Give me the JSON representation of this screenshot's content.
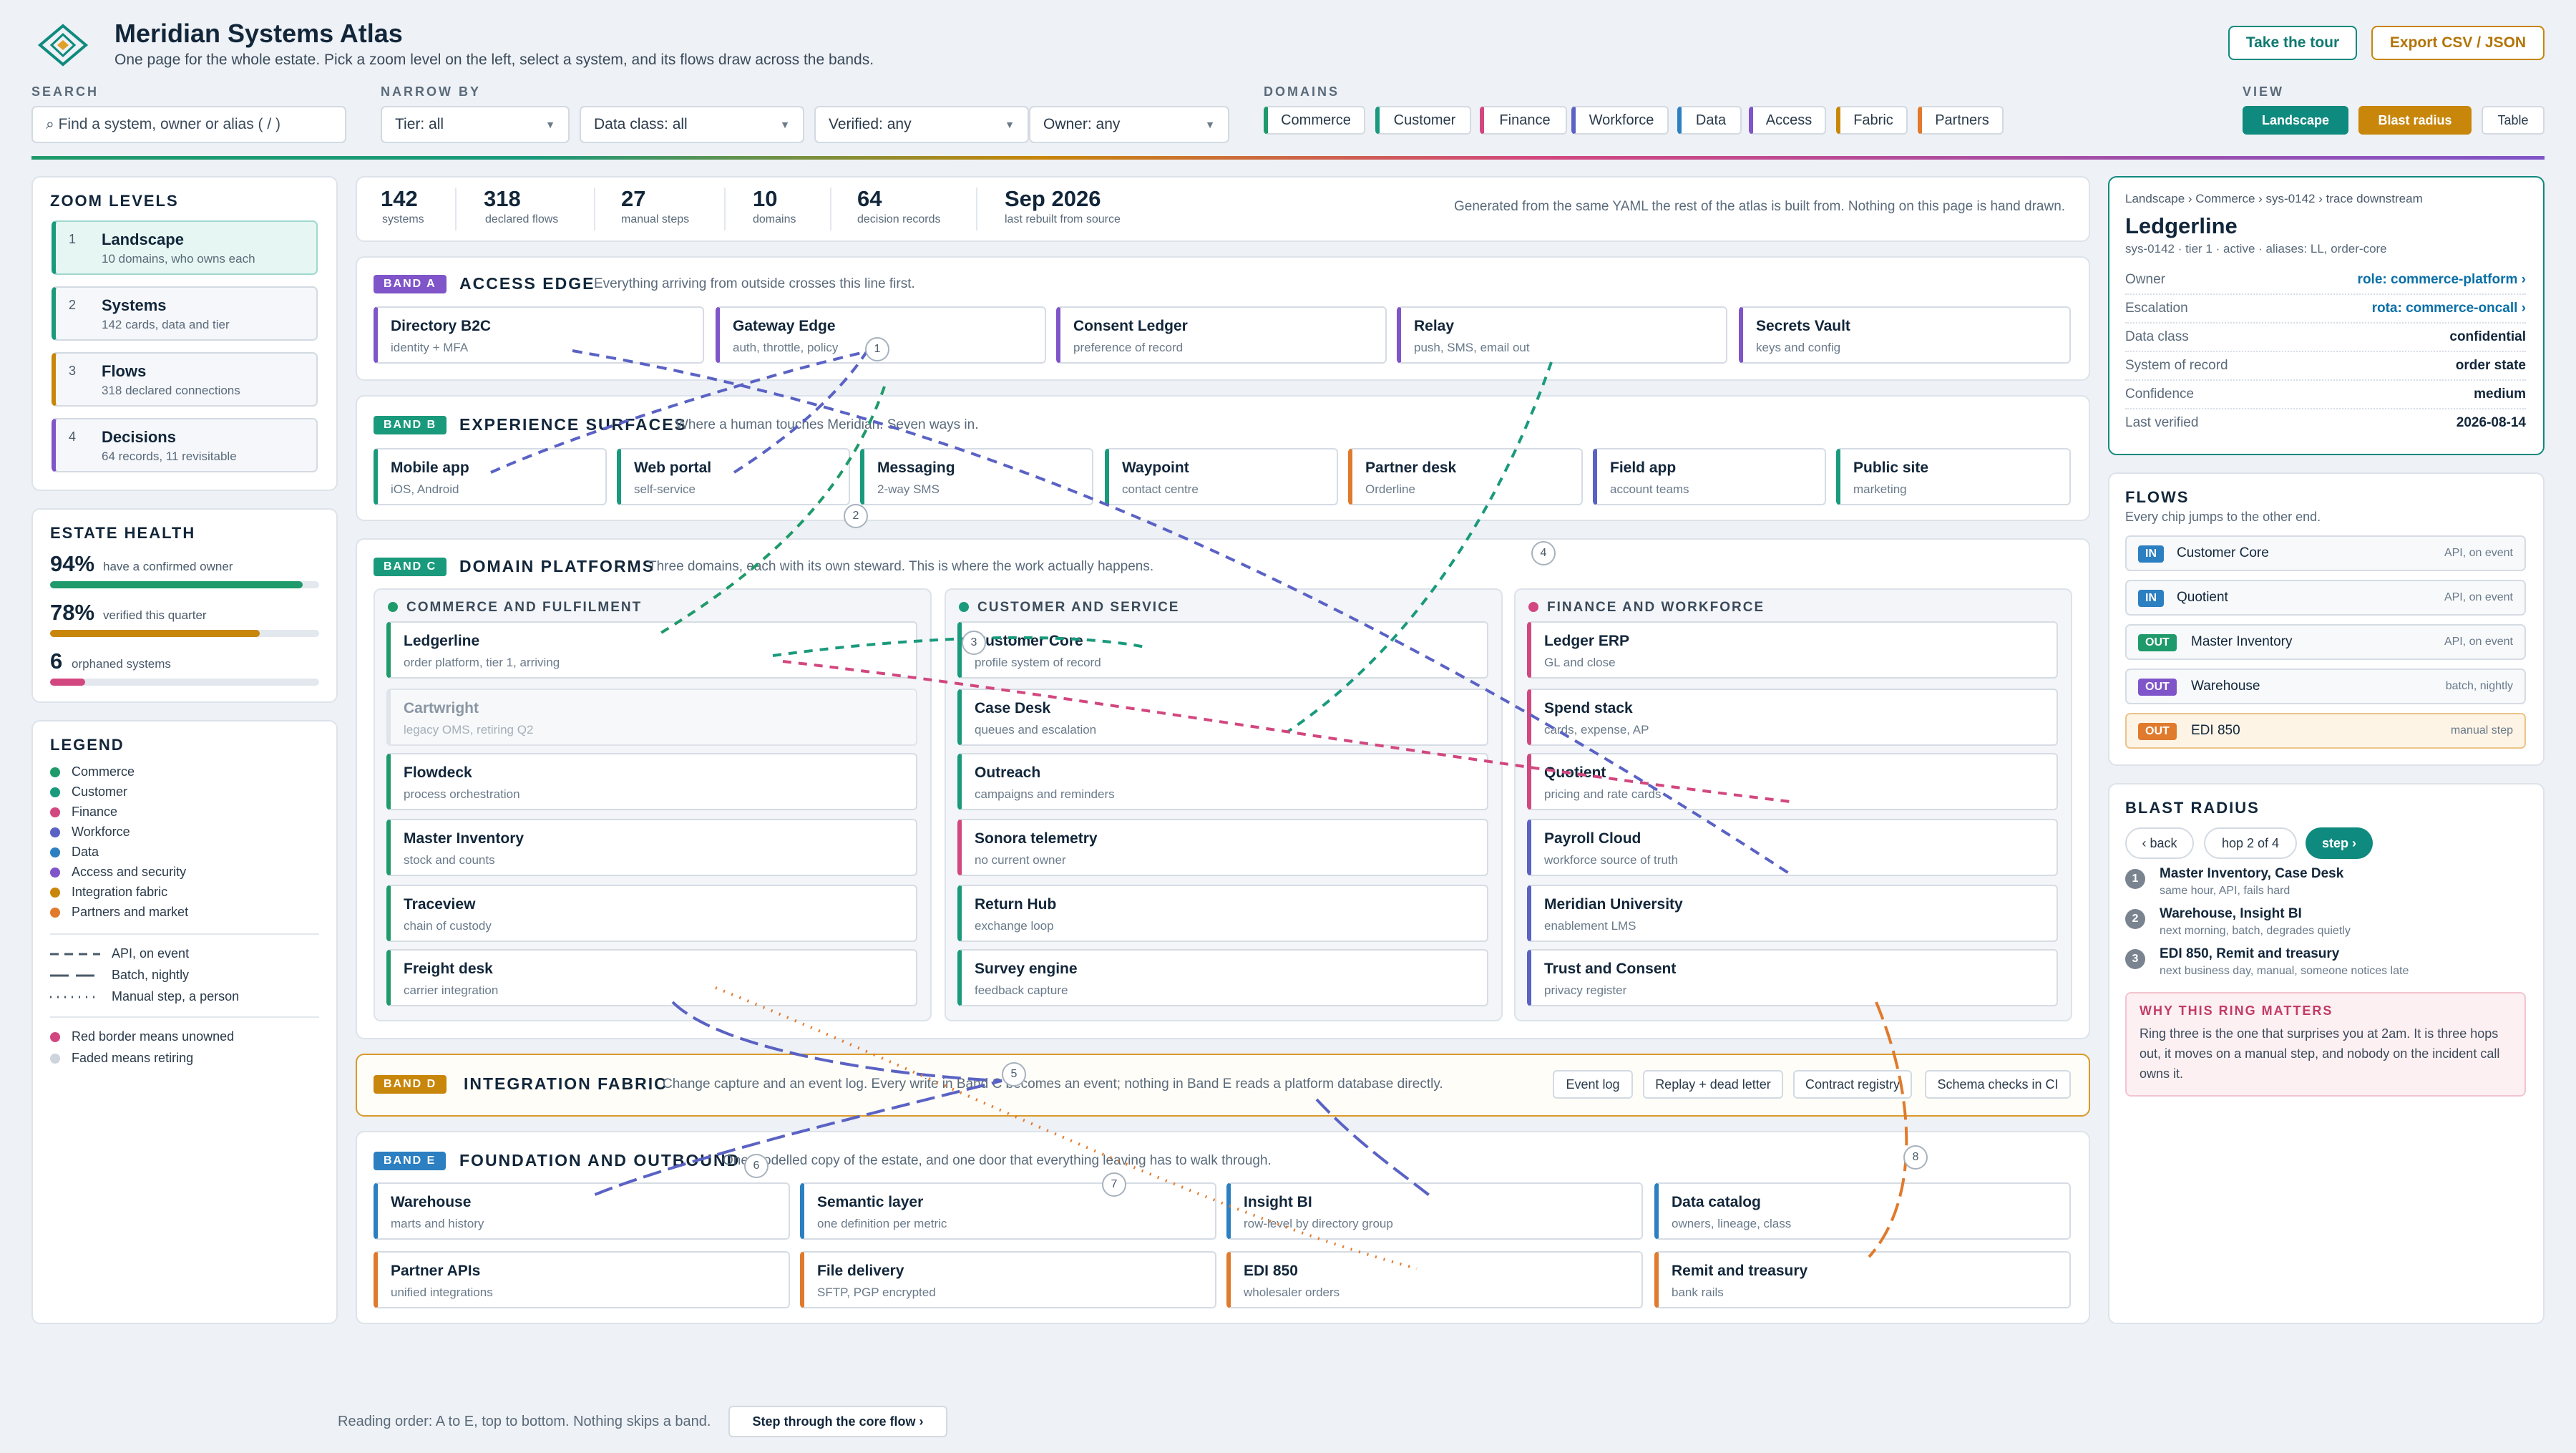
{
  "header": {
    "title": "Meridian Systems Atlas",
    "subtitle": "One page for the whole estate. Pick a zoom level on the left, select a system, and its flows draw across the bands.",
    "tour_label": "Take the tour",
    "export_label": "Export CSV / JSON"
  },
  "filters": {
    "search_label": "SEARCH",
    "search_placeholder": "⌕ Find a system, owner or alias ( / )",
    "narrow_label": "NARROW BY",
    "tier": "Tier: all",
    "data_class": "Data class: all",
    "verified": "Verified: any",
    "owner": "Owner: any",
    "domains_label": "DOMAINS",
    "domains": [
      "Commerce",
      "Customer",
      "Finance",
      "Workforce",
      "Data",
      "Access",
      "Fabric",
      "Partners"
    ],
    "view_label": "VIEW",
    "views": [
      "Landscape",
      "Blast radius",
      "Table"
    ]
  },
  "zoom": {
    "title": "ZOOM LEVELS",
    "levels": [
      {
        "n": "1",
        "title": "Landscape",
        "sub": "10 domains, who owns each"
      },
      {
        "n": "2",
        "title": "Systems",
        "sub": "142 cards, data and tier"
      },
      {
        "n": "3",
        "title": "Flows",
        "sub": "318 declared connections"
      },
      {
        "n": "4",
        "title": "Decisions",
        "sub": "64 records, 11 revisitable"
      }
    ]
  },
  "health": {
    "title": "ESTATE HEALTH",
    "items": [
      {
        "value": "94%",
        "label": "have a confirmed owner",
        "pct": 94
      },
      {
        "value": "78%",
        "label": "verified this quarter",
        "pct": 78
      },
      {
        "value": "6",
        "label": "orphaned systems",
        "pct": 13
      }
    ]
  },
  "legend": {
    "title": "LEGEND",
    "domains": [
      "Commerce",
      "Customer",
      "Finance",
      "Workforce",
      "Data",
      "Access and security",
      "Integration fabric",
      "Partners and market"
    ],
    "lines": [
      "API, on event",
      "Batch, nightly",
      "Manual step, a person"
    ],
    "notes": [
      "Red border means unowned",
      "Faded means retiring"
    ]
  },
  "stats": {
    "items": [
      {
        "value": "142",
        "label": "systems"
      },
      {
        "value": "318",
        "label": "declared flows"
      },
      {
        "value": "27",
        "label": "manual steps"
      },
      {
        "value": "10",
        "label": "domains"
      },
      {
        "value": "64",
        "label": "decision records"
      },
      {
        "value": "Sep 2026",
        "label": "last rebuilt from source"
      }
    ],
    "note": "Generated from the same YAML the rest of the atlas is built from. Nothing on this page is hand drawn."
  },
  "bands": {
    "a": {
      "badge": "BAND A",
      "title": "ACCESS EDGE",
      "desc": "Everything arriving from outside crosses this line first.",
      "cards": [
        {
          "t": "Directory B2C",
          "s": "identity + MFA"
        },
        {
          "t": "Gateway Edge",
          "s": "auth, throttle, policy"
        },
        {
          "t": "Consent Ledger",
          "s": "preference of record"
        },
        {
          "t": "Relay",
          "s": "push, SMS, email out"
        },
        {
          "t": "Secrets Vault",
          "s": "keys and config"
        }
      ]
    },
    "b": {
      "badge": "BAND B",
      "title": "EXPERIENCE SURFACES",
      "desc": "Where a human touches Meridian. Seven ways in.",
      "cards": [
        {
          "t": "Mobile app",
          "s": "iOS, Android"
        },
        {
          "t": "Web portal",
          "s": "self-service"
        },
        {
          "t": "Messaging",
          "s": "2-way SMS"
        },
        {
          "t": "Waypoint",
          "s": "contact centre"
        },
        {
          "t": "Partner desk",
          "s": "Orderline"
        },
        {
          "t": "Field app",
          "s": "account teams"
        },
        {
          "t": "Public site",
          "s": "marketing"
        }
      ]
    },
    "c": {
      "badge": "BAND C",
      "title": "DOMAIN PLATFORMS",
      "desc": "Three domains, each with its own steward. This is where the work actually happens.",
      "groups": [
        {
          "title": "COMMERCE AND FULFILMENT",
          "cards": [
            {
              "t": "Ledgerline",
              "s": "order platform, tier 1, arriving"
            },
            {
              "t": "Cartwright",
              "s": "legacy OMS, retiring Q2"
            },
            {
              "t": "Flowdeck",
              "s": "process orchestration"
            },
            {
              "t": "Master Inventory",
              "s": "stock and counts"
            },
            {
              "t": "Traceview",
              "s": "chain of custody"
            },
            {
              "t": "Freight desk",
              "s": "carrier integration"
            }
          ]
        },
        {
          "title": "CUSTOMER AND SERVICE",
          "cards": [
            {
              "t": "Customer Core",
              "s": "profile system of record"
            },
            {
              "t": "Case Desk",
              "s": "queues and escalation"
            },
            {
              "t": "Outreach",
              "s": "campaigns and reminders"
            },
            {
              "t": "Sonora telemetry",
              "s": "no current owner"
            },
            {
              "t": "Return Hub",
              "s": "exchange loop"
            },
            {
              "t": "Survey engine",
              "s": "feedback capture"
            }
          ]
        },
        {
          "title": "FINANCE AND WORKFORCE",
          "cards": [
            {
              "t": "Ledger ERP",
              "s": "GL and close"
            },
            {
              "t": "Spend stack",
              "s": "cards, expense, AP"
            },
            {
              "t": "Quotient",
              "s": "pricing and rate cards"
            },
            {
              "t": "Payroll Cloud",
              "s": "workforce source of truth"
            },
            {
              "t": "Meridian University",
              "s": "enablement LMS"
            },
            {
              "t": "Trust and Consent",
              "s": "privacy register"
            }
          ]
        }
      ]
    },
    "d": {
      "badge": "BAND D",
      "title": "INTEGRATION FABRIC",
      "desc": "Change capture and an event log. Every write in Band C becomes an event; nothing in Band E reads a platform database directly.",
      "tags": [
        "Event log",
        "Replay + dead letter",
        "Contract registry",
        "Schema checks in CI"
      ]
    },
    "e": {
      "badge": "BAND E",
      "title": "FOUNDATION AND OUTBOUND",
      "desc": "One modelled copy of the estate, and one door that everything leaving has to walk through.",
      "cards": [
        {
          "t": "Warehouse",
          "s": "marts and history"
        },
        {
          "t": "Semantic layer",
          "s": "one definition per metric"
        },
        {
          "t": "Insight BI",
          "s": "row-level by directory group"
        },
        {
          "t": "Data catalog",
          "s": "owners, lineage, class"
        },
        {
          "t": "Partner APIs",
          "s": "unified integrations"
        },
        {
          "t": "File delivery",
          "s": "SFTP, PGP encrypted"
        },
        {
          "t": "EDI 850",
          "s": "wholesaler orders"
        },
        {
          "t": "Remit and treasury",
          "s": "bank rails"
        }
      ]
    }
  },
  "markers": [
    "1",
    "2",
    "3",
    "4",
    "5",
    "6",
    "7",
    "8"
  ],
  "footer": {
    "note": "Reading order: A to E, top to bottom. Nothing skips a band.",
    "step_label": "Step through the core flow ›"
  },
  "detail": {
    "breadcrumb": [
      "Landscape",
      "Commerce",
      "sys-0142",
      "trace downstream"
    ],
    "title": "Ledgerline",
    "meta": "sys-0142 · tier 1 · active · aliases: LL, order-core",
    "rows": [
      {
        "k": "Owner",
        "v": "role: commerce-platform ›"
      },
      {
        "k": "Escalation",
        "v": "rota: commerce-oncall ›"
      },
      {
        "k": "Data class",
        "v": "confidential"
      },
      {
        "k": "System of record",
        "v": "order state"
      },
      {
        "k": "Confidence",
        "v": "medium"
      },
      {
        "k": "Last verified",
        "v": "2026-08-14"
      }
    ]
  },
  "flows": {
    "title": "FLOWS",
    "sub": "Every chip jumps to the other end.",
    "items": [
      {
        "dir": "IN",
        "name": "Customer Core",
        "mode": "API, on event"
      },
      {
        "dir": "IN",
        "name": "Quotient",
        "mode": "API, on event"
      },
      {
        "dir": "OUT",
        "name": "Master Inventory",
        "mode": "API, on event"
      },
      {
        "dir": "OUT",
        "name": "Warehouse",
        "mode": "batch, nightly"
      },
      {
        "dir": "OUT",
        "name": "EDI 850",
        "mode": "manual step"
      }
    ]
  },
  "blast": {
    "title": "BLAST RADIUS",
    "back": "‹ back",
    "hop": "hop 2 of 4",
    "step": "step ›",
    "hops": [
      {
        "n": "1",
        "t": "Master Inventory, Case Desk",
        "s": "same hour, API, fails hard"
      },
      {
        "n": "2",
        "t": "Warehouse, Insight BI",
        "s": "next morning, batch, degrades quietly"
      },
      {
        "n": "3",
        "t": "EDI 850, Remit and treasury",
        "s": "next business day, manual, someone notices late"
      }
    ],
    "why_title": "WHY THIS RING MATTERS",
    "why_text": "Ring three is the one that surprises you at 2am. It is three hops out, it moves on a manual step, and nobody on the incident call owns it."
  },
  "colors": {
    "commerce": "#1f9a6a",
    "customer": "#1a9a7c",
    "finance": "#d2477f",
    "workforce": "#5a62c4",
    "data": "#2c7fc0",
    "access": "#7f55c9",
    "fabric": "#c8860a",
    "partners": "#e07a2c",
    "accent": "#0f8a7e"
  }
}
